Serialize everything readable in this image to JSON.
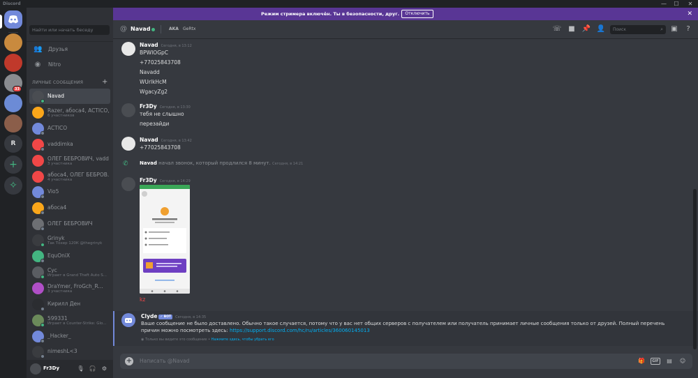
{
  "window": {
    "title": "Discord",
    "controls": [
      "—",
      "☐",
      "✕"
    ]
  },
  "rail": {
    "servers": [
      {
        "name": "home",
        "letter": ""
      },
      {
        "name": "server-1",
        "letter": ""
      },
      {
        "name": "server-2",
        "letter": ""
      },
      {
        "name": "server-3",
        "letter": "",
        "badge": "33"
      },
      {
        "name": "server-4",
        "letter": ""
      },
      {
        "name": "server-5",
        "letter": ""
      },
      {
        "name": "server-r",
        "letter": "R"
      }
    ],
    "add_symbol": "+",
    "explore_symbol": "✧"
  },
  "sidebar": {
    "search_placeholder": "Найти или начать беседу",
    "nav": [
      {
        "label": "Друзья",
        "icon": "👥"
      },
      {
        "label": "Nitro",
        "icon": "◉"
      }
    ],
    "dm_header": "ЛИЧНЫЕ СООБЩЕНИЯ",
    "dm_add": "+",
    "dms": [
      {
        "name": "Navad",
        "sub": "",
        "color": "#4a4d52",
        "status": "#43b581"
      },
      {
        "name": "Razer, абоса4, ACTICO,...",
        "sub": "6 участников",
        "color": "#faa61a",
        "status": ""
      },
      {
        "name": "ACTICO",
        "sub": "",
        "color": "#7289da",
        "status": "#747f8d"
      },
      {
        "name": "vaddimka",
        "sub": "",
        "color": "#f04747",
        "status": "#747f8d"
      },
      {
        "name": "ОЛЕГ БЕБРОВИЧ, vaddim...",
        "sub": "3 участника",
        "color": "#f04747",
        "status": ""
      },
      {
        "name": "абоса4, ОЛЕГ БЕБРОВ...",
        "sub": "4 участника",
        "color": "#f04747",
        "status": ""
      },
      {
        "name": "Vio5",
        "sub": "",
        "color": "#7289da",
        "status": "#747f8d"
      },
      {
        "name": "абоса4",
        "sub": "",
        "color": "#faa61a",
        "status": "#747f8d"
      },
      {
        "name": "ОЛЕГ БЕБРОВИЧ",
        "sub": "",
        "color": "#6d6f73",
        "status": "#747f8d"
      },
      {
        "name": "Grinyk",
        "sub": "Так Тохер 120К @thegrinyk",
        "color": "#3a3c40",
        "status": "#43b581"
      },
      {
        "name": "EquOniX",
        "sub": "",
        "color": "#43b581",
        "status": "#747f8d"
      },
      {
        "name": "Cyc",
        "sub": "Играет в Grand Theft Auto S...",
        "color": "#5a5d62",
        "status": "#43b581"
      },
      {
        "name": "DraYmer, FroGch_R...",
        "sub": "3 участника",
        "color": "#b04fc7",
        "status": ""
      },
      {
        "name": "Кирилл Ден",
        "sub": "",
        "color": "#2b2d31",
        "status": "#747f8d"
      },
      {
        "name": "599331",
        "sub": "Играет в Counter-Strike: Glo...",
        "color": "#6b8a5a",
        "status": "#43b581"
      },
      {
        "name": "_Hacker_",
        "sub": "",
        "color": "#7289da",
        "status": "#747f8d"
      },
      {
        "name": "nimeshL<3",
        "sub": "",
        "color": "#3a3c40",
        "status": "#747f8d"
      }
    ],
    "user": {
      "name": "Fr3Dy"
    }
  },
  "banner": {
    "text": "Режим стримера включён. Ты в безопасности, друг.",
    "button": "Отключить",
    "close": "✕"
  },
  "header": {
    "at": "@",
    "channel": "Navad",
    "aka_label": "AKA",
    "alias": "GeRtx",
    "search_placeholder": "Поиск",
    "search_icon": "⌕"
  },
  "messages": [
    {
      "author": "Navad",
      "time": "Сегодня, в 13:12",
      "lines": [
        "BPWIOGpC",
        "+77025843708",
        "Navadd",
        "WUrlkHcM",
        "WgacyZg2"
      ]
    },
    {
      "author": "Fr3Dy",
      "time": "Сегодня, в 13:30",
      "lines": [
        "тебя не слышно",
        "перезайди"
      ]
    },
    {
      "author": "Navad",
      "time": "Сегодня, в 13:42",
      "lines": [
        "+77025843708"
      ]
    },
    {
      "author": "Fr3Dy",
      "time": "Сегодня, в 14:29",
      "lines": []
    }
  ],
  "call": {
    "author": "Navad",
    "text": "начал звонок, который продлился 8 минут.",
    "time": "Сегодня, в 14:21"
  },
  "attachment_caption": "kz",
  "clyde": {
    "author": "Clyde",
    "badge": "✓ BOT",
    "time": "Сегодня, в 14:35",
    "body": "Ваше сообщение не было доставлено. Обычно такое случается, потому что у вас нет общих серверов с получателем или получатель принимает личные сообщения только от друзей. Полный перечень причин можно посмотреть здесь: ",
    "link": "https://support.discord.com/hc/ru/articles/360060145013",
    "note": "Только вы видите это сообщение • ",
    "note_link": "Нажмите здесь, чтобы убрать его"
  },
  "composer": {
    "placeholder": "Написать @Navad",
    "plus": "+",
    "gif": "GIF"
  },
  "colors": {
    "accent": "#7289da",
    "banner": "#593695",
    "online": "#43b581",
    "link": "#00b0f4"
  }
}
